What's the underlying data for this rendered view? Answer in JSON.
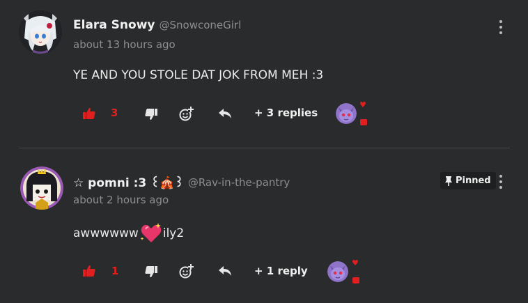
{
  "comments": [
    {
      "name": "Elara Snowy",
      "handle": "@SnowconeGirl",
      "time": "about 13 hours ago",
      "text": "YE AND YOU STOLE DAT JOK FROM MEH :3",
      "likes": "3",
      "replies": "+ 3 replies"
    },
    {
      "name": "☆ pomni :3 ꒰🎪꒱",
      "handle": "@Rav-in-the-pantry",
      "time": "about 2 hours ago",
      "text": "awwwwww",
      "text_after_emoji": "ily2",
      "likes": "1",
      "replies": "+ 1 reply",
      "pinned_label": "Pinned"
    }
  ],
  "colors": {
    "like": "#e02020",
    "background": "#2a2b2c",
    "muted": "#8d8e8f"
  },
  "icons": [
    "thumb-up-icon",
    "thumb-down-icon",
    "add-reaction-icon",
    "reply-icon",
    "heart-icon",
    "chat-icon",
    "pin-icon",
    "more-vertical-icon",
    "sparkling-heart-icon"
  ]
}
